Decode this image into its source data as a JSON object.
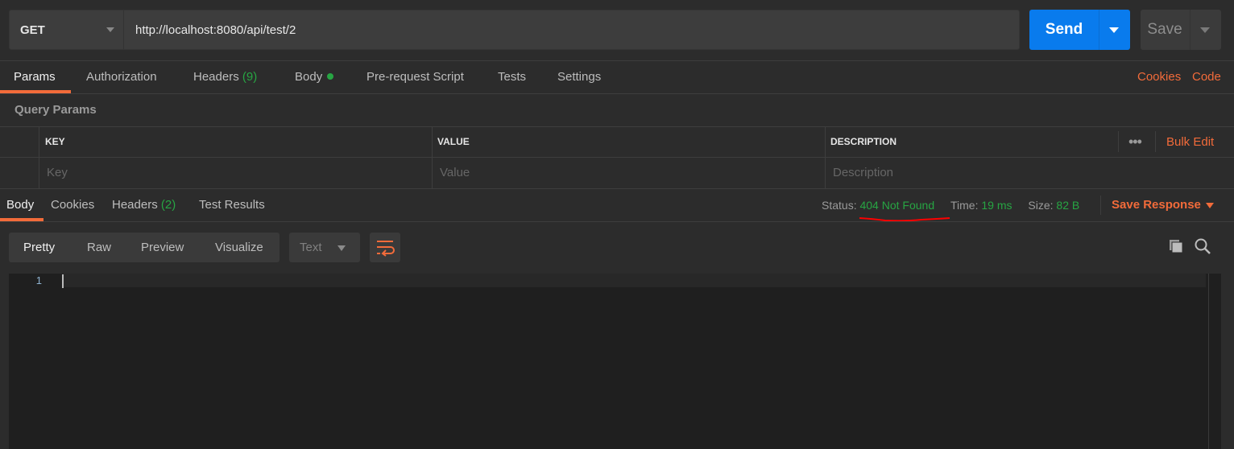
{
  "request": {
    "method": "GET",
    "url": "http://localhost:8080/api/test/2",
    "send_label": "Send",
    "save_label": "Save"
  },
  "request_tabs": [
    {
      "label": "Params",
      "active": true
    },
    {
      "label": "Authorization"
    },
    {
      "label": "Headers",
      "count": "(9)"
    },
    {
      "label": "Body",
      "indicator": "green-dot"
    },
    {
      "label": "Pre-request Script"
    },
    {
      "label": "Tests"
    },
    {
      "label": "Settings"
    }
  ],
  "links": {
    "cookies": "Cookies",
    "code": "Code"
  },
  "query_params": {
    "title": "Query Params",
    "columns": [
      "KEY",
      "VALUE",
      "DESCRIPTION"
    ],
    "placeholders": [
      "Key",
      "Value",
      "Description"
    ],
    "bulk_edit": "Bulk Edit",
    "more_icon": "ellipsis-icon"
  },
  "response_tabs": [
    {
      "label": "Body",
      "active": true
    },
    {
      "label": "Cookies"
    },
    {
      "label": "Headers",
      "count": "(2)"
    },
    {
      "label": "Test Results"
    }
  ],
  "response_meta": {
    "status_label": "Status:",
    "status": "404 Not Found",
    "time_label": "Time:",
    "time": "19 ms",
    "size_label": "Size:",
    "size": "82 B",
    "save_response": "Save Response"
  },
  "view_modes": [
    "Pretty",
    "Raw",
    "Preview",
    "Visualize"
  ],
  "format": "Text",
  "editor": {
    "line_numbers": [
      "1"
    ]
  },
  "colors": {
    "accent": "#f26b3a",
    "send": "#097bed",
    "success": "#27a543",
    "annotation": "#ff0000"
  }
}
